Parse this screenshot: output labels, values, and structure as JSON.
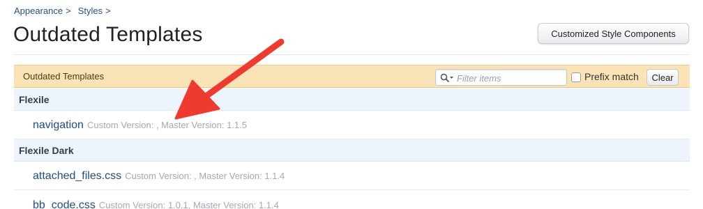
{
  "breadcrumb": {
    "items": [
      "Appearance",
      "Styles"
    ],
    "separator": ">"
  },
  "page": {
    "title": "Outdated Templates",
    "top_button_label": "Customized Style Components"
  },
  "list": {
    "header_label": "Outdated Templates",
    "filter_placeholder": "Filter items",
    "filter_icon": "search-icon",
    "prefix_label": "Prefix match",
    "prefix_checked": false,
    "clear_label": "Clear"
  },
  "groups": [
    {
      "name": "Flexile",
      "templates": [
        {
          "name": "navigation",
          "meta": "Custom Version: , Master Version: 1.1.5"
        }
      ]
    },
    {
      "name": "Flexile Dark",
      "templates": [
        {
          "name": "attached_files.css",
          "meta": "Custom Version: , Master Version: 1.1.4"
        },
        {
          "name": "bb_code.css",
          "meta": "Custom Version: 1.0.1, Master Version: 1.1.4"
        }
      ]
    }
  ],
  "colors": {
    "header_bar": "#fbe3b8",
    "group_bar": "#eef4fb",
    "link": "#1e4c86",
    "annotation_arrow": "#ef3a2f"
  }
}
